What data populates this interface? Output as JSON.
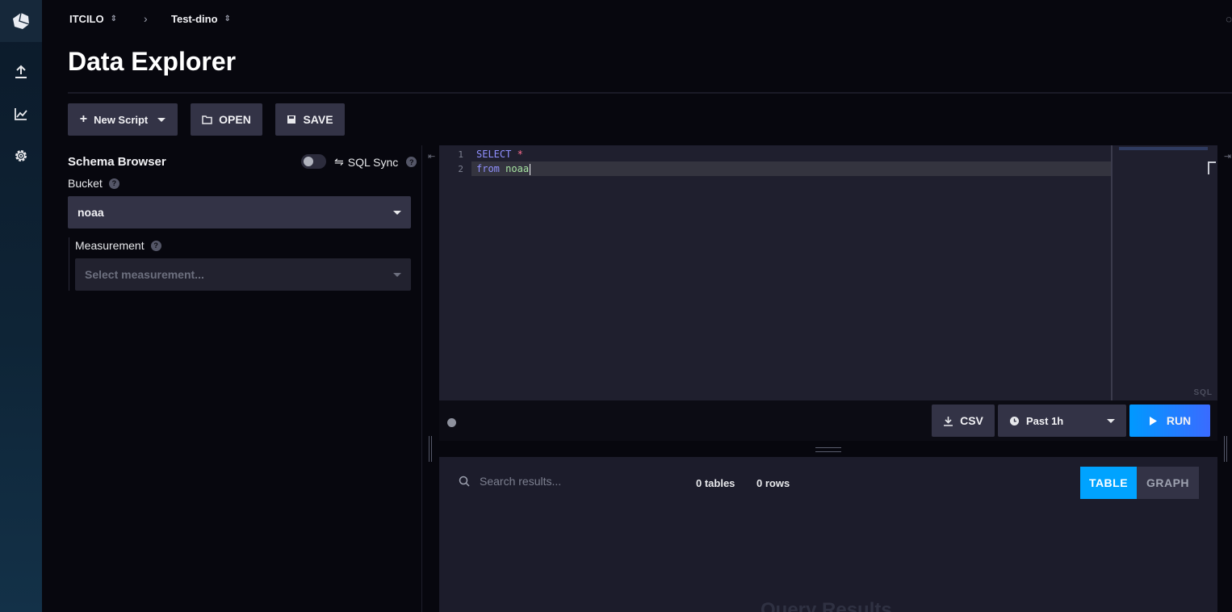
{
  "breadcrumb": {
    "org": "ITCILO",
    "bucket": "Test-dino"
  },
  "page": {
    "title": "Data Explorer"
  },
  "toolbar": {
    "new_script": "New Script",
    "open": "OPEN",
    "save": "SAVE"
  },
  "schema": {
    "title": "Schema Browser",
    "sql_sync": "SQL Sync",
    "sql_sync_enabled": false,
    "bucket_label": "Bucket",
    "bucket_value": "noaa",
    "measurement_label": "Measurement",
    "measurement_placeholder": "Select measurement..."
  },
  "editor": {
    "lines": [
      {
        "num": "1",
        "kw": "SELECT",
        "rest": "*"
      },
      {
        "num": "2",
        "kw": "from",
        "rest": "noaa"
      }
    ],
    "language": "SQL"
  },
  "editor_footer": {
    "csv": "CSV",
    "time_range": "Past 1h",
    "run": "RUN"
  },
  "results": {
    "search_placeholder": "Search results...",
    "tables": "0 tables",
    "rows": "0 rows",
    "table_tab": "TABLE",
    "graph_tab": "GRAPH",
    "placeholder": "Query Results"
  },
  "colors": {
    "accent": "#00a3ff",
    "run": "#2a7cff"
  }
}
